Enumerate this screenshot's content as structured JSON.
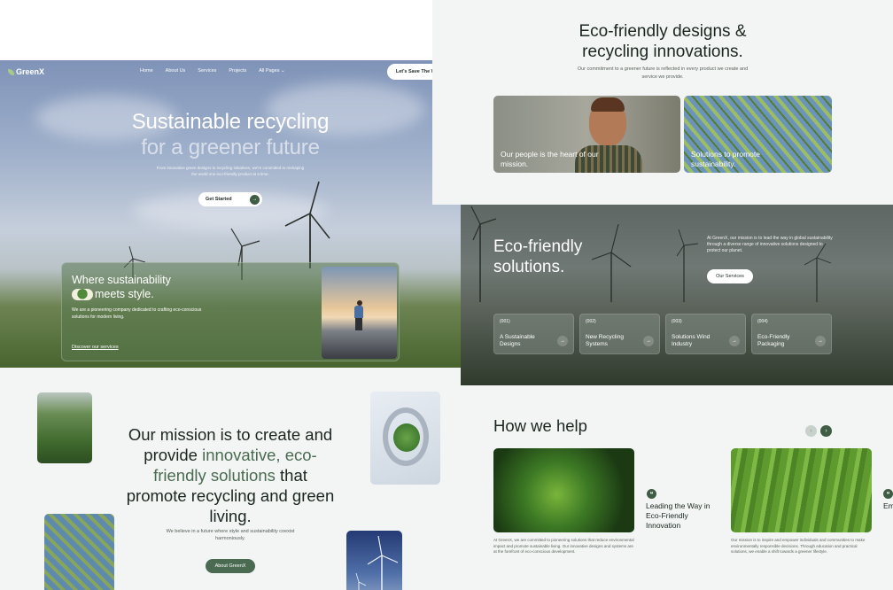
{
  "nav": {
    "logo": "GreenX",
    "links": [
      "Home",
      "About Us",
      "Services",
      "Projects",
      "All Pages ⌄"
    ],
    "cta": "Let's Save The World"
  },
  "hero": {
    "title_line1": "Sustainable recycling",
    "title_line2": "for a greener future",
    "subtitle": "From innovative green designs to recycling initiatives, we're committed to reshaping the world one eco-friendly product at a time.",
    "button": "Get Started",
    "card": {
      "title_line1": "Where sustainability",
      "title_line2": "meets style.",
      "text": "We are a pioneering company dedicated to crafting eco-conscious solutions for modern living.",
      "link": "Discover our services"
    }
  },
  "mission": {
    "title_part1": "Our mission is to create and provide ",
    "title_highlight": "innovative, eco-friendly solutions",
    "title_part2": " that promote recycling and green living.",
    "subtitle": "We believe in a future where style and sustainability coexist harmoniously.",
    "button": "About GreenX"
  },
  "designs": {
    "title_line1": "Eco-friendly designs &",
    "title_line2": "recycling innovations.",
    "subtitle": "Our commitment to a greener future is reflected in every product we create and service we provide.",
    "cards": [
      {
        "caption": "Our people is the heart of our mission."
      },
      {
        "caption": "Solutions to promote sustainability."
      }
    ]
  },
  "solutions": {
    "title_line1": "Eco-friendly",
    "title_line2": "solutions.",
    "text": "At GreenX, our mission is to lead the way in global sustainability through a diverse range of innovative solutions designed to protect our planet.",
    "button": "Our Services",
    "cards": [
      {
        "num": "(001)",
        "label": "A Sustainable Designs"
      },
      {
        "num": "(002)",
        "label": "New Recycling Systems"
      },
      {
        "num": "(003)",
        "label": "Solutions Wind Industry"
      },
      {
        "num": "(004)",
        "label": "Eco-Friendly Packaging"
      }
    ]
  },
  "help": {
    "title": "How we help",
    "items": [
      {
        "heading": "Leading the Way in Eco-Friendly Innovation",
        "text": "At GreenX, we are committed to pioneering solutions that reduce environmental impact and promote sustainable living. Our innovative designs and systems are at the forefront of eco-conscious development."
      },
      {
        "heading": "Em Gre",
        "text": "Our mission is to inspire and empower individuals and communities to make environmentally responsible decisions. Through education and practical solutions, we enable a shift towards a greener lifestyle."
      }
    ]
  },
  "colors": {
    "accent": "#4a6b52",
    "dark_accent": "#3f5d44",
    "page_bg": "#f2f5f3"
  }
}
